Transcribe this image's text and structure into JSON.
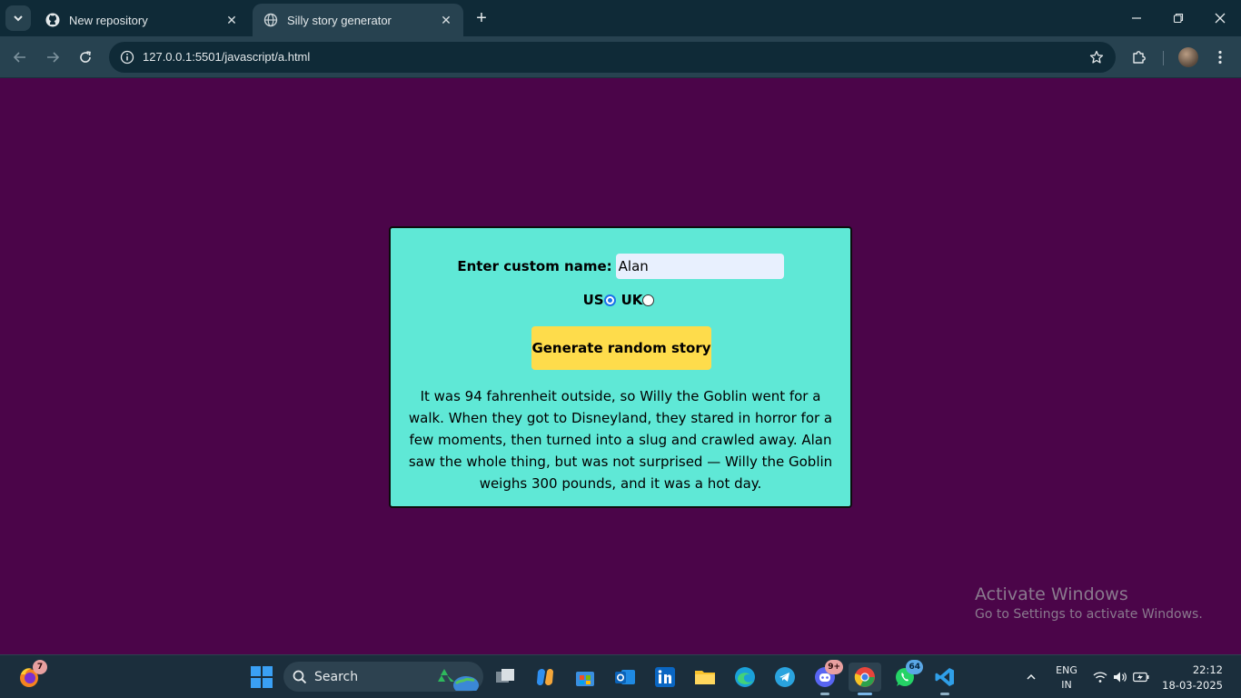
{
  "browser": {
    "tabs": [
      {
        "title": "New repository",
        "active": false,
        "icon": "github-icon"
      },
      {
        "title": "Silly story generator",
        "active": true,
        "icon": "globe-icon"
      }
    ],
    "url": "127.0.0.1:5501/javascript/a.html"
  },
  "page": {
    "background": "#4b0549",
    "card_color": "#5fe8d6",
    "name_label": "Enter custom name:",
    "name_value": "Alan",
    "radio_us": "US",
    "radio_uk": "UK",
    "selected_unit": "US",
    "button_label": "Generate random story",
    "button_color": "#fedc4b",
    "story": "It was 94 fahrenheit outside, so Willy the Goblin went for a walk. When they got to Disneyland, they stared in horror for a few moments, then turned into a slug and crawled away. Alan saw the whole thing, but was not surprised — Willy the Goblin weighs 300 pounds, and it was a hot day."
  },
  "watermark": {
    "title": "Activate Windows",
    "subtitle": "Go to Settings to activate Windows."
  },
  "taskbar": {
    "search_label": "Search",
    "badges": {
      "firefox": "7",
      "discord": "9+",
      "whatsapp": "64"
    },
    "language": "ENG",
    "region": "IN",
    "time": "22:12",
    "date": "18-03-2025"
  }
}
